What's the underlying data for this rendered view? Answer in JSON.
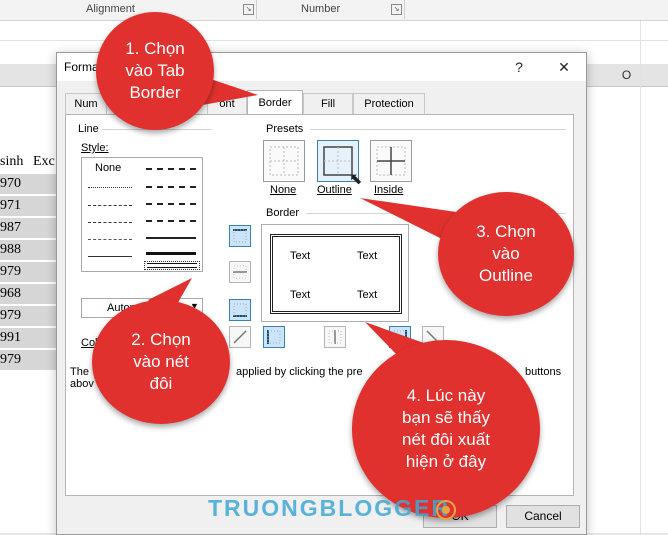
{
  "ribbon": {
    "groups": [
      "Alignment",
      "Number"
    ]
  },
  "sheet": {
    "column_header_right": "O",
    "header_cells": [
      "sinh",
      "Exc"
    ],
    "cells": [
      "970",
      "971",
      "987",
      "988",
      "979",
      "968",
      "979",
      "991",
      "979"
    ]
  },
  "dialog": {
    "title": "Forma",
    "help": "?",
    "close": "✕",
    "tabs": [
      "Num",
      "ont",
      "Border",
      "Fill",
      "Protection"
    ],
    "active_tab": "Border",
    "line_group": "Line",
    "style_label": "Style:",
    "style_none": "None",
    "color_label": "Color:",
    "color_value": "Automatic",
    "presets_label": "Presets",
    "presets": [
      "None",
      "Outline",
      "Inside"
    ],
    "border_label": "Border",
    "preview_text": [
      "Text",
      "Text",
      "Text",
      "Text"
    ],
    "hint_left": "The",
    "hint_left2": "abov",
    "hint_mid": "applied by clicking the pre",
    "hint_right": "buttons",
    "ok": "OK",
    "cancel": "Cancel"
  },
  "callouts": [
    "1. Chọn\nvào Tab\nBorder",
    "2. Chọn\nvào nét\nđôi",
    "3. Chọn\nvào\nOutline",
    "4. Lúc này\nbạn sẽ thấy\nnét đôi xuất\nhiện ở đây"
  ],
  "watermark": "TRUONGBLOGGER",
  "colors": {
    "callout": "#e0312f",
    "selection": "#cce4f7",
    "watermark": "#3fa8d6"
  }
}
